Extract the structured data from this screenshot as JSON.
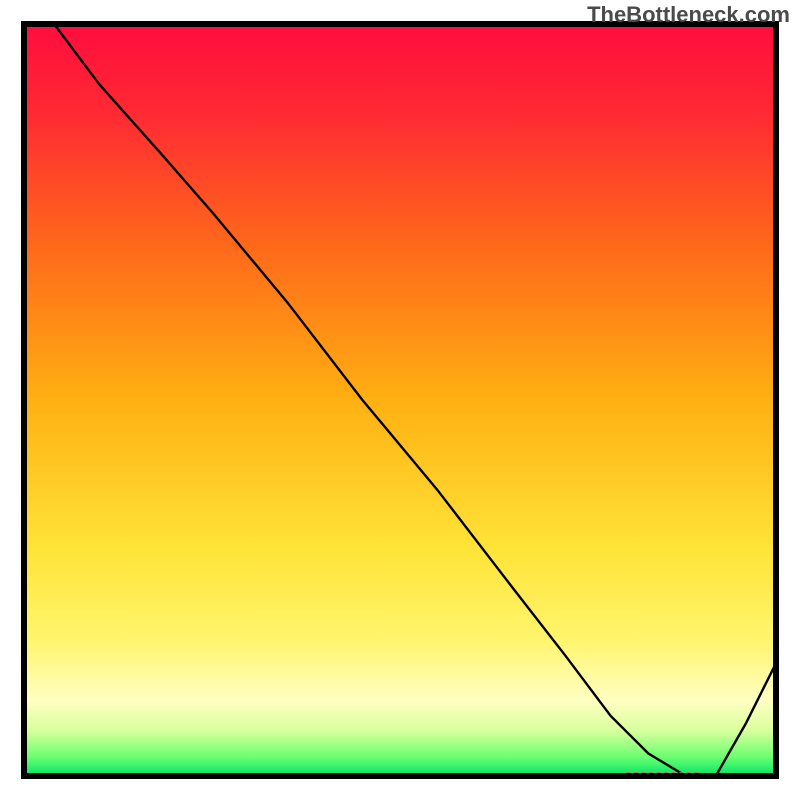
{
  "watermark": "TheBottleneck.com",
  "chart_data": {
    "type": "line",
    "title": "",
    "xlabel": "",
    "ylabel": "",
    "xlim": [
      0,
      100
    ],
    "ylim": [
      0,
      100
    ],
    "x": [
      0,
      4,
      10,
      18,
      25,
      35,
      45,
      55,
      65,
      72,
      78,
      83,
      88,
      92,
      96,
      100
    ],
    "values": [
      100,
      100,
      92,
      83,
      75,
      63,
      50,
      38,
      25,
      16,
      8,
      3,
      0,
      0,
      7,
      15
    ],
    "annotations": [
      {
        "kind": "marker",
        "x_start": 80,
        "x_end": 90,
        "y": 0,
        "color": "#ff4d4d"
      }
    ],
    "gradient_stops": [
      {
        "offset": 0.0,
        "color": "#ff0d3e"
      },
      {
        "offset": 0.12,
        "color": "#ff2a33"
      },
      {
        "offset": 0.3,
        "color": "#ff6a1a"
      },
      {
        "offset": 0.5,
        "color": "#ffb012"
      },
      {
        "offset": 0.7,
        "color": "#ffe438"
      },
      {
        "offset": 0.82,
        "color": "#fff56e"
      },
      {
        "offset": 0.9,
        "color": "#ffffc2"
      },
      {
        "offset": 0.94,
        "color": "#d8ff9c"
      },
      {
        "offset": 0.975,
        "color": "#6aff70"
      },
      {
        "offset": 1.0,
        "color": "#00e566"
      }
    ]
  },
  "frame": {
    "outer": 800,
    "margin": 24,
    "stroke": "#000000"
  }
}
